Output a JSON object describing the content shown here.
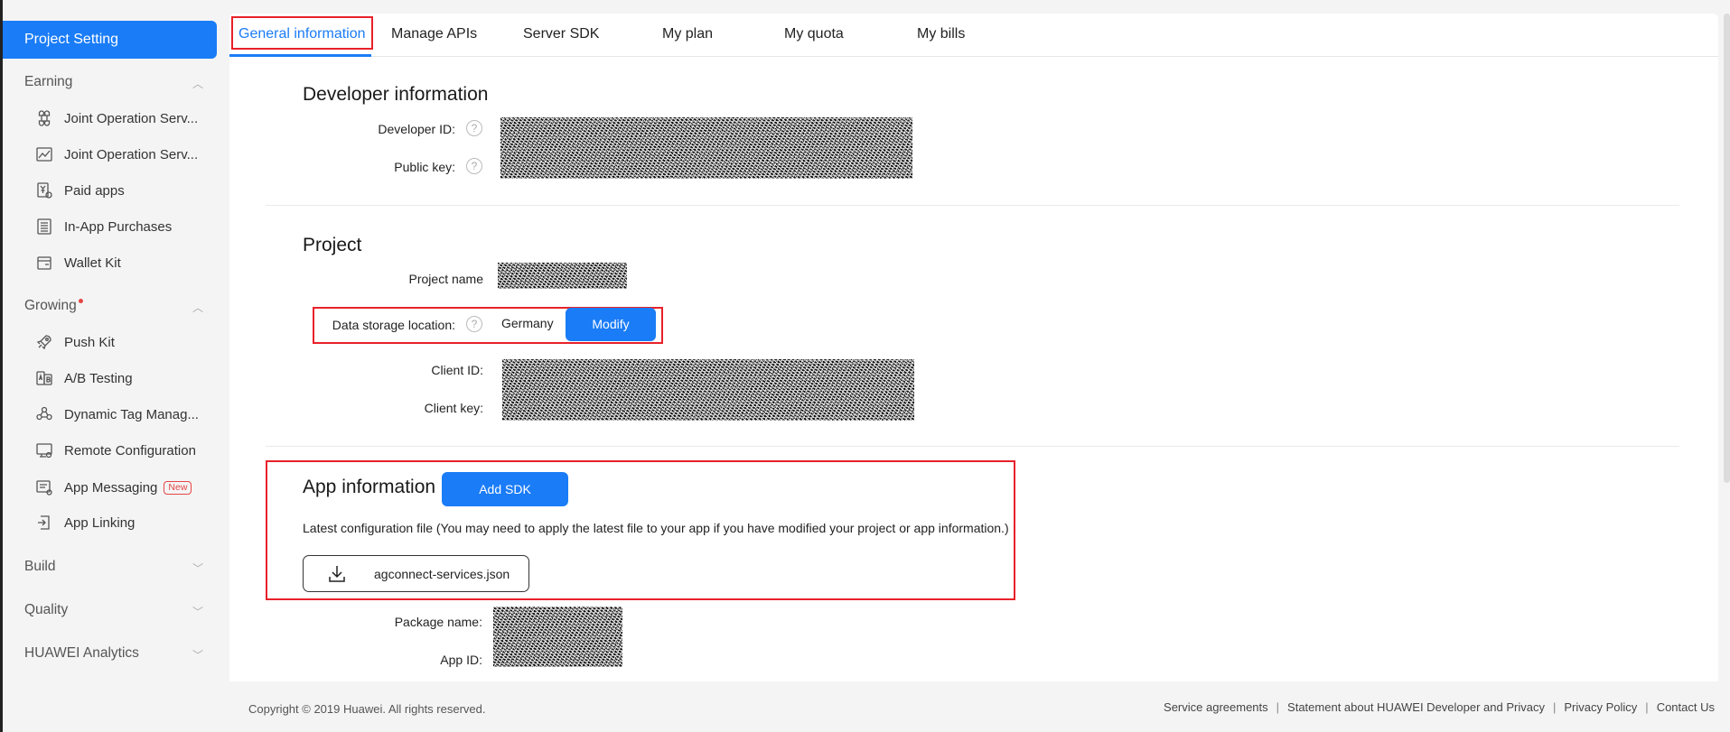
{
  "sidebar": {
    "active_label": "Project Setting",
    "groups": [
      {
        "label": "Earning",
        "chevron": "up"
      },
      {
        "label": "Growing",
        "chevron": "up",
        "has_dot": true
      },
      {
        "label": "Build",
        "chevron": "down"
      },
      {
        "label": "Quality",
        "chevron": "down"
      },
      {
        "label": "HUAWEI Analytics",
        "chevron": "down"
      }
    ],
    "earning_items": [
      {
        "label": "Joint Operation Serv...",
        "icon": "command-icon"
      },
      {
        "label": "Joint Operation Serv...",
        "icon": "chart-icon"
      },
      {
        "label": "Paid apps",
        "icon": "yen-receipt-icon"
      },
      {
        "label": "In-App Purchases",
        "icon": "receipt-icon"
      },
      {
        "label": "Wallet Kit",
        "icon": "wallet-icon"
      }
    ],
    "growing_items": [
      {
        "label": "Push Kit",
        "icon": "rocket-icon"
      },
      {
        "label": "A/B Testing",
        "icon": "ab-testing-icon"
      },
      {
        "label": "Dynamic Tag Manag...",
        "icon": "tag-nodes-icon"
      },
      {
        "label": "Remote Configuration",
        "icon": "remote-config-icon"
      },
      {
        "label": "App Messaging",
        "icon": "message-icon",
        "badge": "New"
      },
      {
        "label": "App Linking",
        "icon": "link-icon"
      }
    ]
  },
  "tabs": [
    {
      "label": "General information",
      "active": true
    },
    {
      "label": "Manage APIs"
    },
    {
      "label": "Server SDK"
    },
    {
      "label": "My plan"
    },
    {
      "label": "My quota"
    },
    {
      "label": "My bills"
    }
  ],
  "developer": {
    "title": "Developer information",
    "developer_id_label": "Developer ID:",
    "public_key_label": "Public key:"
  },
  "project": {
    "title": "Project",
    "project_name_label": "Project name",
    "storage_label": "Data storage location:",
    "storage_value": "Germany",
    "modify_label": "Modify",
    "client_id_label": "Client ID:",
    "client_key_label": "Client key:"
  },
  "app": {
    "title": "App information",
    "add_sdk_label": "Add SDK",
    "config_desc": "Latest configuration file (You may need to apply the latest file to your app if you have modified your project or app information.)",
    "config_file": "agconnect-services.json",
    "package_name_label": "Package name:",
    "app_id_label": "App ID:"
  },
  "footer": {
    "copyright": "Copyright © 2019 Huawei. All rights reserved.",
    "links": [
      "Service agreements",
      "Statement about HUAWEI Developer and Privacy",
      "Privacy Policy",
      "Contact Us"
    ]
  },
  "colors": {
    "accent": "#1a7cf7",
    "highlight_border": "#e8212a"
  }
}
